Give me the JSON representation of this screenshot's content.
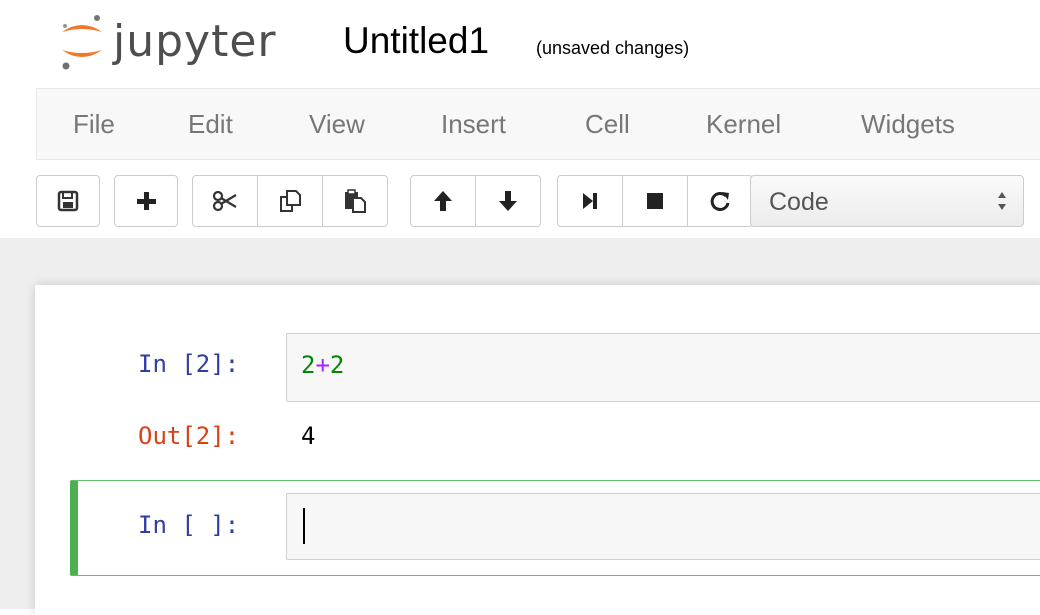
{
  "header": {
    "logo_text": "jupyter",
    "notebook_name": "Untitled1",
    "save_status": "(unsaved changes)"
  },
  "menu": {
    "items": [
      "File",
      "Edit",
      "View",
      "Insert",
      "Cell",
      "Kernel",
      "Widgets"
    ]
  },
  "toolbar": {
    "buttons": [
      {
        "icon": "save-icon"
      },
      {
        "icon": "plus-icon"
      },
      {
        "icon": "scissors-icon"
      },
      {
        "icon": "copy-icon"
      },
      {
        "icon": "paste-icon"
      },
      {
        "icon": "arrow-up-icon"
      },
      {
        "icon": "arrow-down-icon"
      },
      {
        "icon": "step-forward-icon"
      },
      {
        "icon": "stop-icon"
      },
      {
        "icon": "restart-icon"
      }
    ],
    "cell_type": "Code"
  },
  "cells": [
    {
      "prompt_in": "In [2]:",
      "code_tokens": [
        {
          "text": "2",
          "kind": "number"
        },
        {
          "text": "+",
          "kind": "operator"
        },
        {
          "text": "2",
          "kind": "number"
        }
      ],
      "prompt_out": "Out[2]:",
      "output": "4"
    },
    {
      "prompt_in": "In [ ]:",
      "code": "",
      "selected": true
    }
  ],
  "colors": {
    "prompt_in": "#303F9F",
    "prompt_out": "#D84315",
    "selected_border": "#4caf50",
    "code_number": "#008800",
    "code_operator": "#AA22FF"
  }
}
